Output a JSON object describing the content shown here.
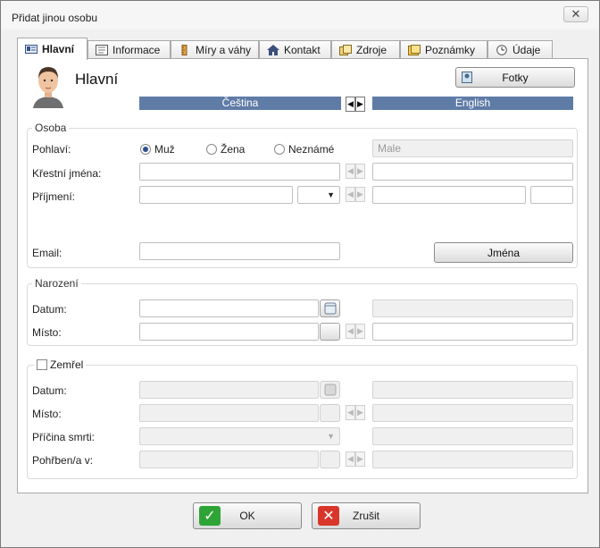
{
  "window": {
    "title": "Přidat jinou osobu",
    "close_glyph": "✕"
  },
  "tabs": [
    {
      "label": "Hlavní",
      "icon": "id-card-icon"
    },
    {
      "label": "Informace",
      "icon": "info-icon"
    },
    {
      "label": "Míry a váhy",
      "icon": "ruler-icon"
    },
    {
      "label": "Kontakt",
      "icon": "house-icon"
    },
    {
      "label": "Zdroje",
      "icon": "sources-icon"
    },
    {
      "label": "Poznámky",
      "icon": "notes-icon"
    },
    {
      "label": "Údaje",
      "icon": "clock-icon"
    }
  ],
  "header": {
    "title": "Hlavní",
    "photos_button": "Fotky"
  },
  "languages": {
    "left": "Čeština",
    "right": "English",
    "swap_left": "◀",
    "swap_right": "▶"
  },
  "person": {
    "group_title": "Osoba",
    "gender_label": "Pohlaví:",
    "gender_options": [
      "Muž",
      "Žena",
      "Neznámé"
    ],
    "gender_selected": "Muž",
    "gender_translation": "Male",
    "given_names_label": "Křestní jména:",
    "surname_label": "Příjmení:",
    "surname_dropdown_arrow": "▼",
    "email_label": "Email:",
    "names_button": "Jména"
  },
  "birth": {
    "group_title": "Narození",
    "date_label": "Datum:",
    "place_label": "Místo:"
  },
  "death": {
    "checkbox_label": "Zemřel",
    "date_label": "Datum:",
    "place_label": "Místo:",
    "cause_label": "Příčina smrti:",
    "cause_dropdown_arrow": "▼",
    "buried_label": "Pohřben/a v:"
  },
  "footer": {
    "ok": "OK",
    "cancel": "Zrušit",
    "ok_glyph": "✓",
    "cancel_glyph": "✕"
  },
  "colors": {
    "lang_bar": "#5f7ca7",
    "ok_icon": "#2fa436",
    "cancel_icon": "#d9362b"
  }
}
